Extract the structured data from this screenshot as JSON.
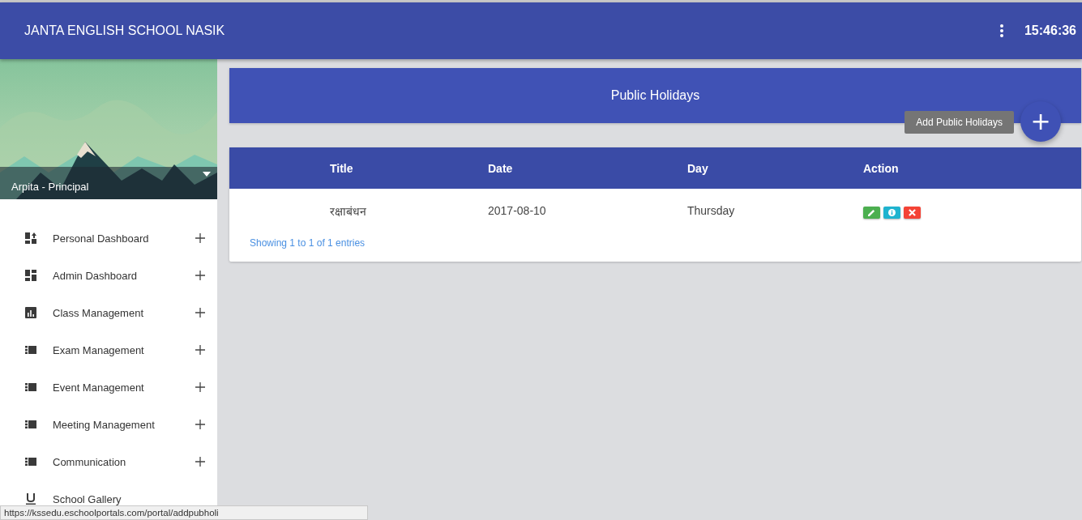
{
  "header": {
    "title": "JANTA ENGLISH SCHOOL NASIK",
    "time": "15:46:36"
  },
  "profile": {
    "name": "Arpita - Principal"
  },
  "sidebar": {
    "items": [
      {
        "label": "Personal Dashboard",
        "kind": "personal",
        "expandable": true
      },
      {
        "label": "Admin Dashboard",
        "kind": "dashboard",
        "expandable": true
      },
      {
        "label": "Class Management",
        "kind": "chart",
        "expandable": true
      },
      {
        "label": "Exam Management",
        "kind": "list",
        "expandable": true
      },
      {
        "label": "Event Management",
        "kind": "list",
        "expandable": true
      },
      {
        "label": "Meeting Management",
        "kind": "list",
        "expandable": true
      },
      {
        "label": "Communication",
        "kind": "list",
        "expandable": true
      },
      {
        "label": "School Gallery",
        "kind": "gallery",
        "expandable": false
      }
    ]
  },
  "page": {
    "title": "Public Holidays",
    "add_tooltip": "Add Public Holidays",
    "add_button": "+"
  },
  "table": {
    "columns": [
      "Title",
      "Date",
      "Day",
      "Action"
    ],
    "rows": [
      {
        "cells": [
          "रक्षाबंधन",
          "2017-08-10",
          "Thursday"
        ]
      }
    ],
    "info": "Showing 1 to 1 of 1 entries"
  },
  "status_bar": "https://kssedu.eschoolportals.com/portal/addpubholi"
}
